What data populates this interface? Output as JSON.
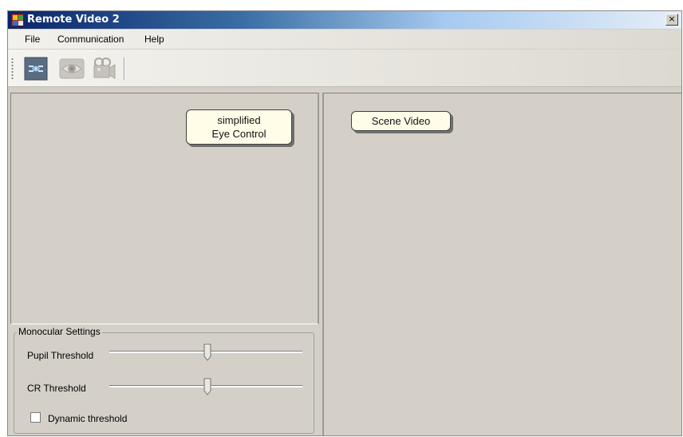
{
  "window": {
    "title": "Remote Video 2",
    "close_glyph": "×"
  },
  "menu": {
    "items": [
      "File",
      "Communication",
      "Help"
    ]
  },
  "toolbar": {
    "buttons": [
      {
        "icon": "connect-icon",
        "state": "active"
      },
      {
        "icon": "eye-icon",
        "state": "disabled"
      },
      {
        "icon": "camera-icon",
        "state": "disabled"
      }
    ]
  },
  "eye_panel": {
    "callout": [
      "simplified",
      "Eye Control"
    ]
  },
  "scene_panel": {
    "callout": "Scene Video"
  },
  "monocular": {
    "title": "Monocular Settings",
    "pupil_label": "Pupil Threshold",
    "pupil_value": 0.51,
    "cr_label": "CR Threshold",
    "cr_value": 0.51,
    "dynamic_label": "Dynamic threshold",
    "dynamic_checked": false
  },
  "colors": {
    "face": "#d4d0c8",
    "title_active": "#0a246a",
    "callout_bg": "#fffde8"
  }
}
